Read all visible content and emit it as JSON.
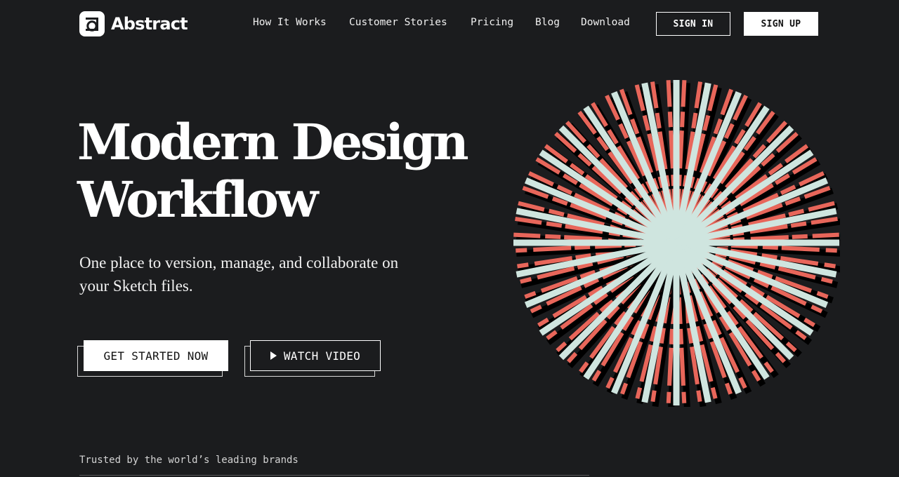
{
  "brand": {
    "name": "Abstract",
    "logo_icon": "abstract-logo-icon"
  },
  "nav": {
    "items": [
      {
        "label": "How It Works"
      },
      {
        "label": "Customer Stories"
      },
      {
        "label": "Pricing"
      },
      {
        "label": "Blog"
      },
      {
        "label": "Download"
      }
    ],
    "sign_in": "SIGN IN",
    "sign_up": "SIGN UP"
  },
  "hero": {
    "headline_line1": "Modern Design",
    "headline_line2": "Workflow",
    "subhead": "One place to version, manage, and collaborate on your Sketch files.",
    "primary_cta": "GET STARTED NOW",
    "secondary_cta": "WATCH VIDEO",
    "secondary_cta_icon": "play-icon"
  },
  "illustration": {
    "name": "starburst-illustration",
    "colors": {
      "mint": "#cfe5df",
      "coral": "#e8665a",
      "shadow": "#000000"
    }
  },
  "trusted": {
    "label": "Trusted by the world’s leading brands"
  },
  "colors": {
    "background": "#1b1c1e",
    "text": "#ffffff"
  }
}
